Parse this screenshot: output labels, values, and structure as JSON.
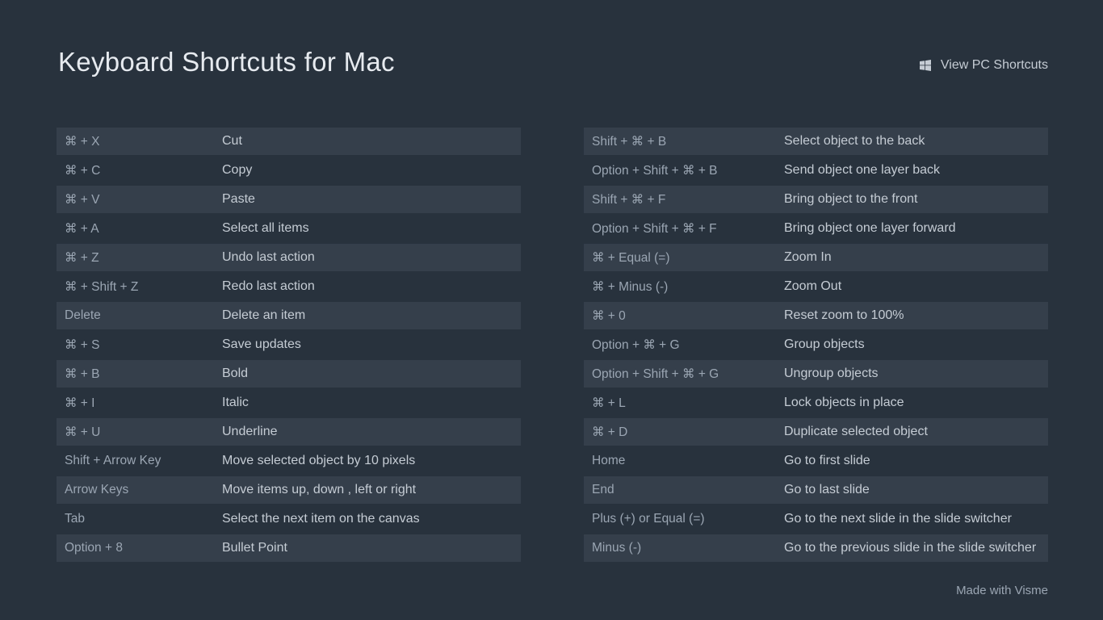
{
  "title": "Keyboard Shortcuts for Mac",
  "link_label": "View PC Shortcuts",
  "footer": "Made with Visme",
  "left": [
    {
      "key": "⌘ + X",
      "desc": "Cut"
    },
    {
      "key": "⌘ + C",
      "desc": "Copy"
    },
    {
      "key": "⌘ + V",
      "desc": "Paste"
    },
    {
      "key": "⌘ + A",
      "desc": "Select all items"
    },
    {
      "key": "⌘ + Z",
      "desc": "Undo last action"
    },
    {
      "key": "⌘ + Shift + Z",
      "desc": "Redo last action"
    },
    {
      "key": "Delete",
      "desc": "Delete an item"
    },
    {
      "key": "⌘ + S",
      "desc": "Save updates"
    },
    {
      "key": "⌘ + B",
      "desc": "Bold"
    },
    {
      "key": "⌘ + I",
      "desc": "Italic"
    },
    {
      "key": "⌘ + U",
      "desc": "Underline"
    },
    {
      "key": "Shift + Arrow Key",
      "desc": "Move selected object by 10 pixels"
    },
    {
      "key": "Arrow Keys",
      "desc": "Move items up, down , left or right"
    },
    {
      "key": "Tab",
      "desc": "Select the next item on the canvas"
    },
    {
      "key": "Option + 8",
      "desc": "Bullet Point"
    }
  ],
  "right": [
    {
      "key": "Shift + ⌘ + B",
      "desc": "Select object to the back"
    },
    {
      "key": "Option + Shift + ⌘ + B",
      "desc": "Send object one layer back"
    },
    {
      "key": "Shift + ⌘ + F",
      "desc": "Bring object to the front"
    },
    {
      "key": "Option + Shift + ⌘ + F",
      "desc": "Bring object one layer forward"
    },
    {
      "key": "⌘ + Equal (=)",
      "desc": "Zoom In"
    },
    {
      "key": "⌘ + Minus (-)",
      "desc": "Zoom Out"
    },
    {
      "key": "⌘ + 0",
      "desc": "Reset zoom to 100%"
    },
    {
      "key": "Option + ⌘ + G",
      "desc": "Group objects"
    },
    {
      "key": "Option + Shift + ⌘ + G",
      "desc": "Ungroup objects"
    },
    {
      "key": "⌘ + L",
      "desc": "Lock objects in place"
    },
    {
      "key": "⌘ + D",
      "desc": "Duplicate selected object"
    },
    {
      "key": "Home",
      "desc": "Go to first slide"
    },
    {
      "key": "End",
      "desc": "Go to last slide"
    },
    {
      "key": "Plus (+) or Equal (=)",
      "desc": "Go to the next slide in the slide switcher"
    },
    {
      "key": "Minus (-)",
      "desc": "Go to the previous slide in the slide switcher"
    }
  ]
}
